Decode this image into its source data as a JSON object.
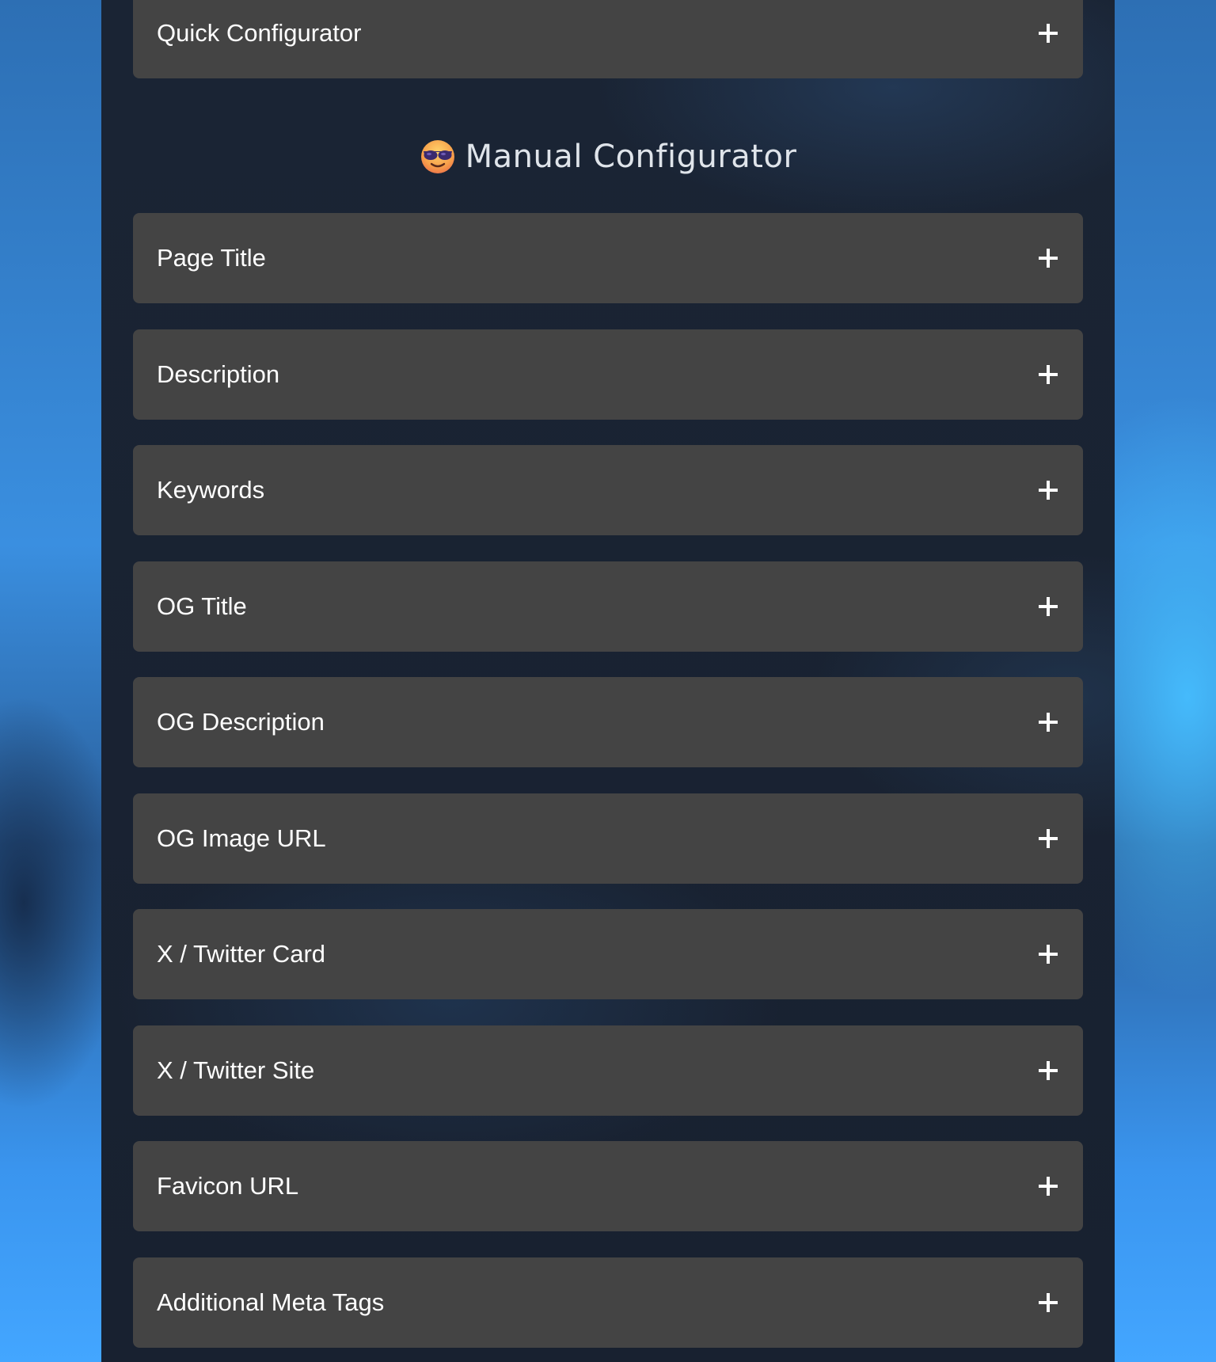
{
  "quick_configurator": {
    "label": "Quick Configurator",
    "expand_icon": "plus-icon"
  },
  "manual_configurator": {
    "heading": "Manual Configurator",
    "heading_icon": "sunglasses-face-emoji",
    "items": [
      {
        "label": "Page Title",
        "expand_icon": "plus-icon"
      },
      {
        "label": "Description",
        "expand_icon": "plus-icon"
      },
      {
        "label": "Keywords",
        "expand_icon": "plus-icon"
      },
      {
        "label": "OG Title",
        "expand_icon": "plus-icon"
      },
      {
        "label": "OG Description",
        "expand_icon": "plus-icon"
      },
      {
        "label": "OG Image URL",
        "expand_icon": "plus-icon"
      },
      {
        "label": "X / Twitter Card",
        "expand_icon": "plus-icon"
      },
      {
        "label": "X / Twitter Site",
        "expand_icon": "plus-icon"
      },
      {
        "label": "Favicon URL",
        "expand_icon": "plus-icon"
      },
      {
        "label": "Additional Meta Tags",
        "expand_icon": "plus-icon"
      }
    ]
  },
  "colors": {
    "panel_background": "#1a2434",
    "accordion_background": "#444444",
    "text": "#ffffff",
    "heading_text": "#dfe4ea",
    "page_background_accent": "#3a95ef"
  }
}
